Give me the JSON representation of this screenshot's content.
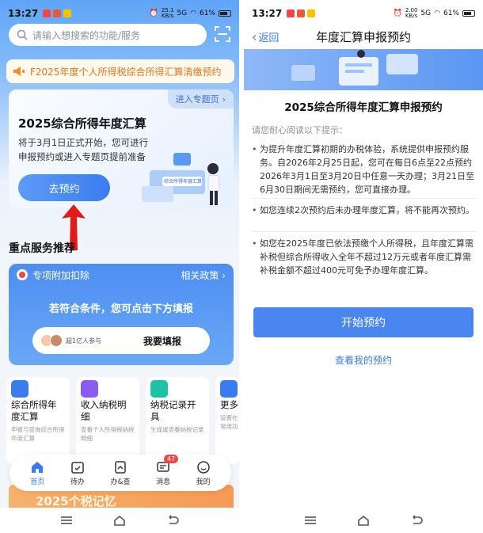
{
  "status_left": {
    "time": "13:27",
    "net": "25.1\nKB/s",
    "signal": "5G",
    "battery": "61%"
  },
  "status_right": {
    "time": "13:27",
    "net": "2.00\nKB/s",
    "signal": "5G",
    "battery": "61%"
  },
  "left": {
    "search_placeholder": "请输入想搜索的功能/服务",
    "notice": "F2025年度个人所得税综合所得汇算清缴预约",
    "hero": {
      "topic_link": "进入专题页",
      "title": "2025综合所得年度汇算",
      "desc": "将于3月1日正式开始，您可进行申报预约或进入专题页提前准备",
      "button": "去预约",
      "illustration_text": "综合所得年度汇算"
    },
    "section_title": "重点服务推荐",
    "deduction_card": {
      "title": "专项附加扣除",
      "policy_link": "相关政策",
      "message": "若符合条件，您可点击下方填报",
      "users": "超1亿人参与",
      "fill_button": "我要填报"
    },
    "tiles": [
      {
        "title": "综合所得年度汇算",
        "sub": "申报与查询综合所得年度汇算",
        "color": "#3a7cf0"
      },
      {
        "title": "收入纳税明细",
        "sub": "查看个人所得税纳税明细",
        "color": "#8a5cf0"
      },
      {
        "title": "纳税记录开具",
        "sub": "生成或查看纳税记录",
        "color": "#1fc2a6"
      },
      {
        "title": "更多I",
        "sub": "设置在常用功",
        "color": "#3a7cf0"
      }
    ],
    "tabs": [
      {
        "label": "首页",
        "active": true
      },
      {
        "label": "待办"
      },
      {
        "label": "办&查"
      },
      {
        "label": "消息",
        "badge": "47"
      },
      {
        "label": "我的"
      }
    ],
    "bottom_banner": "2025个税记忆"
  },
  "right": {
    "back": "返回",
    "title": "年度汇算申报预约",
    "heading": "2025综合所得年度汇算申报预约",
    "lead": "请您耐心阅读以下提示：",
    "paragraphs": [
      "为提升年度汇算初期的办税体验，系统提供申报预约服务。自2026年2月25日起，您可在每日6点至22点预约2026年3月1日至3月20日中任意一天办理；3月21日至6月30日期间无需预约，您可直接办理。",
      "如您连续2次预约后未办理年度汇算，将不能再次预约。",
      "如您在2025年度已依法预缴个人所得税，且年度汇算需补税但综合所得收入全年不超过12万元或者年度汇算需补税金额不超过400元可免予办理年度汇算。"
    ],
    "start_button": "开始预约",
    "my_link": "查看我的预约"
  }
}
